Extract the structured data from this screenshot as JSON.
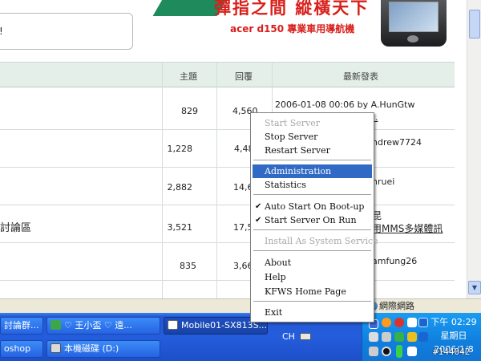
{
  "banner": {
    "headline": "彈指之間 縱橫天下",
    "subline": "acer d150 專業車用導航機"
  },
  "notice": {
    "text": "!"
  },
  "table": {
    "headers": {
      "topics": "主題",
      "replies": "回覆",
      "latest": "最新發表"
    },
    "rows": [
      {
        "title": "",
        "topics": "829",
        "replies": "4,560",
        "latest_line1": "2006-01-08 00:06 by A.HunGtw",
        "latest_line2": "..."
      },
      {
        "title": "",
        "topics": "1,228",
        "replies": "4,48",
        "latest_line1": "ndrew7724",
        "latest_line2": ""
      },
      {
        "title": "",
        "topics": "2,882",
        "replies": "14,6",
        "latest_line1": "nruei",
        "latest_line2": ""
      },
      {
        "title": "討論區",
        "topics": "3,521",
        "replies": "17,5",
        "latest_line1": "昆",
        "latest_line2": "用MMS多媒體訊"
      },
      {
        "title": "",
        "topics": "835",
        "replies": "3,66",
        "latest_line1": "amfung26",
        "latest_line2": ""
      }
    ]
  },
  "statusbar": {
    "zone": "網際網路"
  },
  "taskbar": {
    "buttons": [
      {
        "label": "討論群...",
        "color": "#f2c44a"
      },
      {
        "label": "♡ 王小盃 ♡ 遠...",
        "color": "#3da64a"
      },
      {
        "label": "Mobile01-SX813S...",
        "color": "#ffffff"
      },
      {
        "label": "oshop",
        "color": "#1c3f8c"
      },
      {
        "label": "本機磁碟 (D:)",
        "color": "#d9d9d9"
      }
    ],
    "lang": "CH",
    "clock": {
      "period_time": "下午 02:29",
      "weekday": "星期日",
      "date": "2006/1/8"
    },
    "tag": "#144042"
  },
  "menu": {
    "items": [
      {
        "label": "Start Server",
        "disabled": true,
        "checked": false
      },
      {
        "label": "Stop Server",
        "disabled": false,
        "checked": false
      },
      {
        "label": "Restart Server",
        "disabled": false,
        "checked": false
      },
      {
        "label": "Administration",
        "disabled": false,
        "checked": false,
        "highlighted": true
      },
      {
        "label": "Statistics",
        "disabled": false,
        "checked": false
      },
      {
        "label": "Auto Start On Boot-up",
        "disabled": false,
        "checked": true
      },
      {
        "label": "Start Server On Run",
        "disabled": false,
        "checked": true
      },
      {
        "label": "Install As System Service",
        "disabled": true,
        "checked": false
      },
      {
        "label": "About",
        "disabled": false,
        "checked": false
      },
      {
        "label": "Help",
        "disabled": false,
        "checked": false
      },
      {
        "label": "KFWS Home Page",
        "disabled": false,
        "checked": false
      },
      {
        "label": "Exit",
        "disabled": false,
        "checked": false
      }
    ],
    "check_glyph": "✔"
  },
  "colors": {
    "highlight": "#316ac5",
    "taskbar": "#245ddc",
    "tray": "#0f7fde",
    "banner_red": "#d8201c"
  }
}
